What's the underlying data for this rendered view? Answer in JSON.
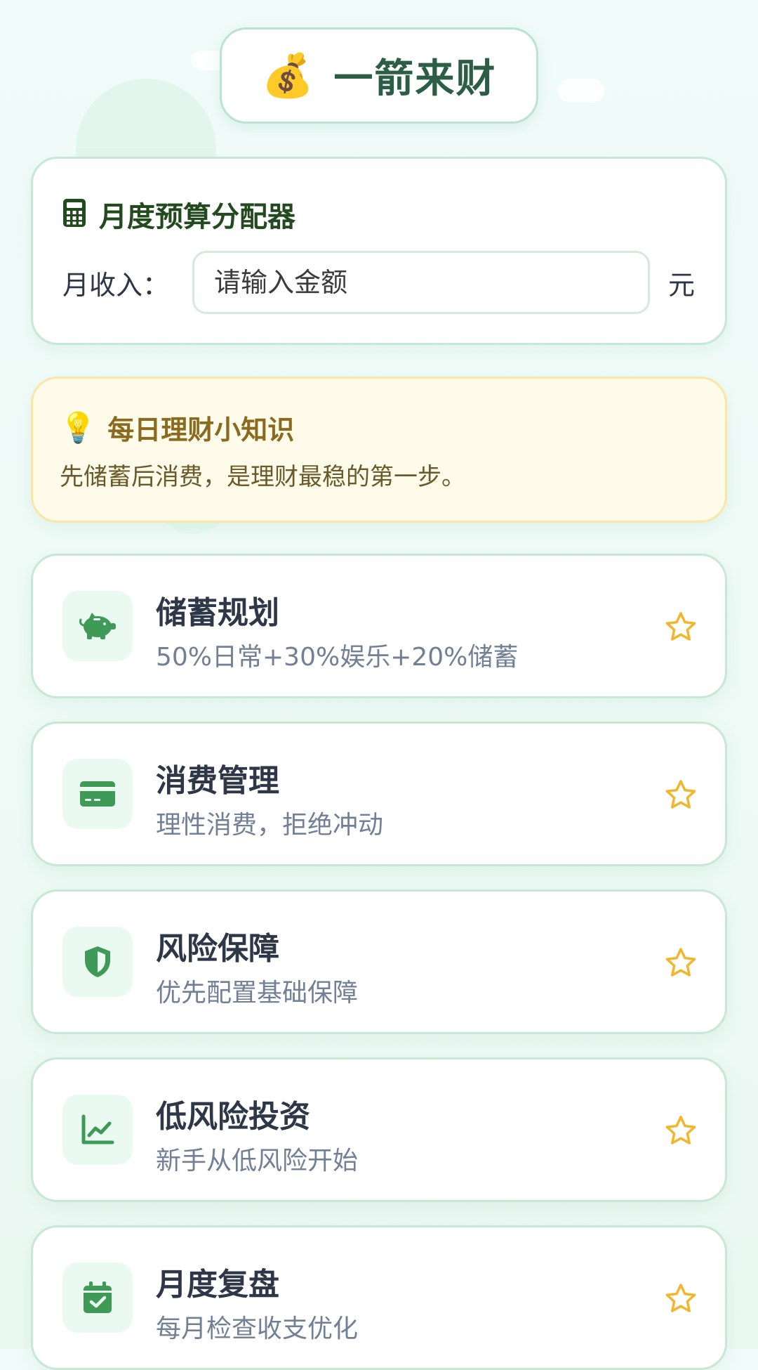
{
  "header": {
    "icon": "money-bag-icon",
    "icon_glyph": "💰",
    "title": "一箭来财"
  },
  "budget": {
    "title_icon": "calculator-icon",
    "title": "月度预算分配器",
    "income_label": "月收入：",
    "income_placeholder": "请输入金额",
    "income_value": "",
    "unit": "元"
  },
  "tip": {
    "icon": "lightbulb-icon",
    "icon_glyph": "💡",
    "title": "每日理财小知识",
    "text": "先储蓄后消费，是理财最稳的第一步。"
  },
  "features": [
    {
      "icon": "piggy-bank-icon",
      "title": "储蓄规划",
      "desc": "50%日常+30%娱乐+20%储蓄"
    },
    {
      "icon": "credit-card-icon",
      "title": "消费管理",
      "desc": "理性消费，拒绝冲动"
    },
    {
      "icon": "shield-icon",
      "title": "风险保障",
      "desc": "优先配置基础保障"
    },
    {
      "icon": "chart-line-icon",
      "title": "低风险投资",
      "desc": "新手从低风险开始"
    },
    {
      "icon": "calendar-check-icon",
      "title": "月度复盘",
      "desc": "每月检查收支优化"
    }
  ],
  "colors": {
    "accent_green": "#3f9a57",
    "star_yellow": "#f2b62c",
    "card_border": "#c7e8d2",
    "tip_bg": "#fffbea"
  }
}
